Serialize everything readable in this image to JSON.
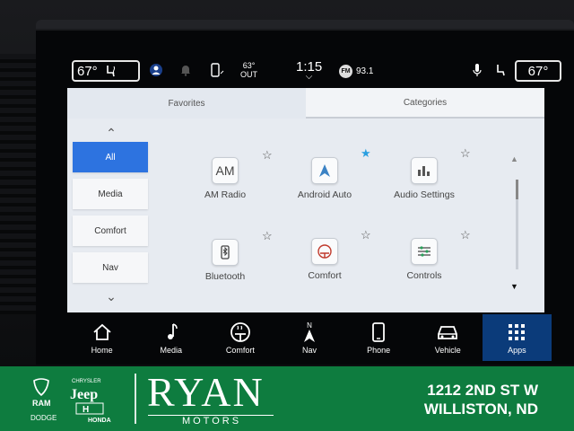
{
  "status_bar": {
    "driver_temp": "67°",
    "passenger_temp": "67°",
    "outside_temp": "63°",
    "outside_label": "OUT",
    "time": "1:15",
    "radio_badge": "FM",
    "radio_freq": "93.1"
  },
  "tabs": [
    {
      "label": "Favorites"
    },
    {
      "label": "Categories"
    }
  ],
  "categories": [
    {
      "label": "All",
      "active": true
    },
    {
      "label": "Media"
    },
    {
      "label": "Comfort"
    },
    {
      "label": "Nav"
    }
  ],
  "apps": [
    {
      "label": "AM Radio",
      "icon_text": "AM",
      "icon": "am-radio-icon",
      "favorite": false
    },
    {
      "label": "Android Auto",
      "icon_text": "",
      "icon": "android-auto-icon",
      "favorite": true
    },
    {
      "label": "Audio Settings",
      "icon_text": "",
      "icon": "audio-settings-icon",
      "favorite": false
    },
    {
      "label": "Bluetooth",
      "icon_text": "",
      "icon": "bluetooth-icon",
      "favorite": false
    },
    {
      "label": "Comfort",
      "icon_text": "",
      "icon": "comfort-icon",
      "favorite": false
    },
    {
      "label": "Controls",
      "icon_text": "",
      "icon": "controls-icon",
      "favorite": false
    }
  ],
  "bottom_nav": [
    {
      "label": "Home",
      "icon": "home-icon"
    },
    {
      "label": "Media",
      "icon": "music-note-icon"
    },
    {
      "label": "Comfort",
      "icon": "steering-heat-icon"
    },
    {
      "label": "Nav",
      "icon": "compass-icon",
      "icon_text": "N"
    },
    {
      "label": "Phone",
      "icon": "phone-icon"
    },
    {
      "label": "Vehicle",
      "icon": "vehicle-icon"
    },
    {
      "label": "Apps",
      "icon": "apps-grid-icon",
      "active": true
    }
  ],
  "dealer": {
    "brands": [
      "RAM",
      "CHRYSLER",
      "Jeep",
      "DODGE",
      "HONDA"
    ],
    "name": "RYAN",
    "sub": "MOTORS",
    "address_line1": "1212 2ND ST W",
    "address_line2": "WILLISTON, ND"
  },
  "colors": {
    "accent_blue": "#2d73e0",
    "favorite_star": "#2a9fe0",
    "dealer_green": "#0e7c3f",
    "active_nav": "#0b3b7a"
  }
}
